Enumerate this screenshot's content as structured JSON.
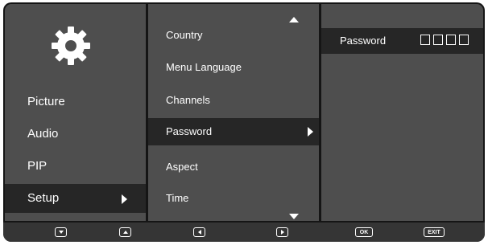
{
  "left_menu": {
    "icon": "gear-icon",
    "items": [
      {
        "label": "Picture"
      },
      {
        "label": "Audio"
      },
      {
        "label": "PIP"
      },
      {
        "label": "Setup",
        "selected": true
      }
    ]
  },
  "setup_menu": {
    "items": [
      {
        "label": "Country"
      },
      {
        "label": "Menu Language"
      },
      {
        "label": "Channels"
      },
      {
        "label": "Password",
        "selected": true
      },
      {
        "label": "Aspect"
      },
      {
        "label": "Time"
      }
    ]
  },
  "password_panel": {
    "label": "Password",
    "digit_boxes": 4
  },
  "footer": {
    "buttons": [
      {
        "name": "down-button",
        "icon": "triangle-down-icon"
      },
      {
        "name": "up-button",
        "icon": "triangle-up-icon"
      },
      {
        "name": "left-button",
        "icon": "triangle-left-icon"
      },
      {
        "name": "right-button",
        "icon": "triangle-right-icon"
      },
      {
        "name": "ok-button",
        "label": "OK"
      },
      {
        "name": "exit-button",
        "label": "EXIT"
      }
    ]
  },
  "colors": {
    "frame": "#151515",
    "panel": "#4e4e4e",
    "selected": "#262626",
    "footer": "#353535",
    "text": "#ffffff"
  }
}
